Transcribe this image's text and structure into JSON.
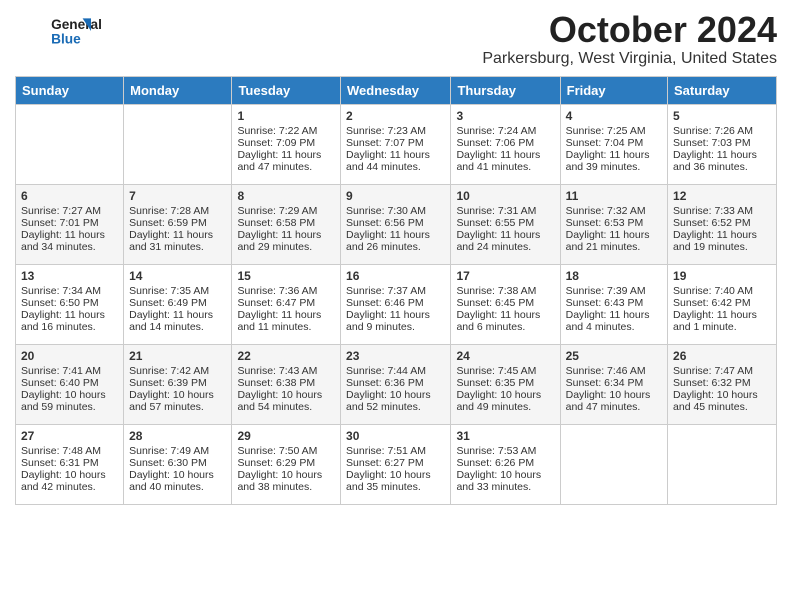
{
  "logo": {
    "line1": "General",
    "line2": "Blue"
  },
  "title": "October 2024",
  "location": "Parkersburg, West Virginia, United States",
  "days_of_week": [
    "Sunday",
    "Monday",
    "Tuesday",
    "Wednesday",
    "Thursday",
    "Friday",
    "Saturday"
  ],
  "weeks": [
    [
      {
        "day": "",
        "sunrise": "",
        "sunset": "",
        "daylight": ""
      },
      {
        "day": "",
        "sunrise": "",
        "sunset": "",
        "daylight": ""
      },
      {
        "day": "1",
        "sunrise": "Sunrise: 7:22 AM",
        "sunset": "Sunset: 7:09 PM",
        "daylight": "Daylight: 11 hours and 47 minutes."
      },
      {
        "day": "2",
        "sunrise": "Sunrise: 7:23 AM",
        "sunset": "Sunset: 7:07 PM",
        "daylight": "Daylight: 11 hours and 44 minutes."
      },
      {
        "day": "3",
        "sunrise": "Sunrise: 7:24 AM",
        "sunset": "Sunset: 7:06 PM",
        "daylight": "Daylight: 11 hours and 41 minutes."
      },
      {
        "day": "4",
        "sunrise": "Sunrise: 7:25 AM",
        "sunset": "Sunset: 7:04 PM",
        "daylight": "Daylight: 11 hours and 39 minutes."
      },
      {
        "day": "5",
        "sunrise": "Sunrise: 7:26 AM",
        "sunset": "Sunset: 7:03 PM",
        "daylight": "Daylight: 11 hours and 36 minutes."
      }
    ],
    [
      {
        "day": "6",
        "sunrise": "Sunrise: 7:27 AM",
        "sunset": "Sunset: 7:01 PM",
        "daylight": "Daylight: 11 hours and 34 minutes."
      },
      {
        "day": "7",
        "sunrise": "Sunrise: 7:28 AM",
        "sunset": "Sunset: 6:59 PM",
        "daylight": "Daylight: 11 hours and 31 minutes."
      },
      {
        "day": "8",
        "sunrise": "Sunrise: 7:29 AM",
        "sunset": "Sunset: 6:58 PM",
        "daylight": "Daylight: 11 hours and 29 minutes."
      },
      {
        "day": "9",
        "sunrise": "Sunrise: 7:30 AM",
        "sunset": "Sunset: 6:56 PM",
        "daylight": "Daylight: 11 hours and 26 minutes."
      },
      {
        "day": "10",
        "sunrise": "Sunrise: 7:31 AM",
        "sunset": "Sunset: 6:55 PM",
        "daylight": "Daylight: 11 hours and 24 minutes."
      },
      {
        "day": "11",
        "sunrise": "Sunrise: 7:32 AM",
        "sunset": "Sunset: 6:53 PM",
        "daylight": "Daylight: 11 hours and 21 minutes."
      },
      {
        "day": "12",
        "sunrise": "Sunrise: 7:33 AM",
        "sunset": "Sunset: 6:52 PM",
        "daylight": "Daylight: 11 hours and 19 minutes."
      }
    ],
    [
      {
        "day": "13",
        "sunrise": "Sunrise: 7:34 AM",
        "sunset": "Sunset: 6:50 PM",
        "daylight": "Daylight: 11 hours and 16 minutes."
      },
      {
        "day": "14",
        "sunrise": "Sunrise: 7:35 AM",
        "sunset": "Sunset: 6:49 PM",
        "daylight": "Daylight: 11 hours and 14 minutes."
      },
      {
        "day": "15",
        "sunrise": "Sunrise: 7:36 AM",
        "sunset": "Sunset: 6:47 PM",
        "daylight": "Daylight: 11 hours and 11 minutes."
      },
      {
        "day": "16",
        "sunrise": "Sunrise: 7:37 AM",
        "sunset": "Sunset: 6:46 PM",
        "daylight": "Daylight: 11 hours and 9 minutes."
      },
      {
        "day": "17",
        "sunrise": "Sunrise: 7:38 AM",
        "sunset": "Sunset: 6:45 PM",
        "daylight": "Daylight: 11 hours and 6 minutes."
      },
      {
        "day": "18",
        "sunrise": "Sunrise: 7:39 AM",
        "sunset": "Sunset: 6:43 PM",
        "daylight": "Daylight: 11 hours and 4 minutes."
      },
      {
        "day": "19",
        "sunrise": "Sunrise: 7:40 AM",
        "sunset": "Sunset: 6:42 PM",
        "daylight": "Daylight: 11 hours and 1 minute."
      }
    ],
    [
      {
        "day": "20",
        "sunrise": "Sunrise: 7:41 AM",
        "sunset": "Sunset: 6:40 PM",
        "daylight": "Daylight: 10 hours and 59 minutes."
      },
      {
        "day": "21",
        "sunrise": "Sunrise: 7:42 AM",
        "sunset": "Sunset: 6:39 PM",
        "daylight": "Daylight: 10 hours and 57 minutes."
      },
      {
        "day": "22",
        "sunrise": "Sunrise: 7:43 AM",
        "sunset": "Sunset: 6:38 PM",
        "daylight": "Daylight: 10 hours and 54 minutes."
      },
      {
        "day": "23",
        "sunrise": "Sunrise: 7:44 AM",
        "sunset": "Sunset: 6:36 PM",
        "daylight": "Daylight: 10 hours and 52 minutes."
      },
      {
        "day": "24",
        "sunrise": "Sunrise: 7:45 AM",
        "sunset": "Sunset: 6:35 PM",
        "daylight": "Daylight: 10 hours and 49 minutes."
      },
      {
        "day": "25",
        "sunrise": "Sunrise: 7:46 AM",
        "sunset": "Sunset: 6:34 PM",
        "daylight": "Daylight: 10 hours and 47 minutes."
      },
      {
        "day": "26",
        "sunrise": "Sunrise: 7:47 AM",
        "sunset": "Sunset: 6:32 PM",
        "daylight": "Daylight: 10 hours and 45 minutes."
      }
    ],
    [
      {
        "day": "27",
        "sunrise": "Sunrise: 7:48 AM",
        "sunset": "Sunset: 6:31 PM",
        "daylight": "Daylight: 10 hours and 42 minutes."
      },
      {
        "day": "28",
        "sunrise": "Sunrise: 7:49 AM",
        "sunset": "Sunset: 6:30 PM",
        "daylight": "Daylight: 10 hours and 40 minutes."
      },
      {
        "day": "29",
        "sunrise": "Sunrise: 7:50 AM",
        "sunset": "Sunset: 6:29 PM",
        "daylight": "Daylight: 10 hours and 38 minutes."
      },
      {
        "day": "30",
        "sunrise": "Sunrise: 7:51 AM",
        "sunset": "Sunset: 6:27 PM",
        "daylight": "Daylight: 10 hours and 35 minutes."
      },
      {
        "day": "31",
        "sunrise": "Sunrise: 7:53 AM",
        "sunset": "Sunset: 6:26 PM",
        "daylight": "Daylight: 10 hours and 33 minutes."
      },
      {
        "day": "",
        "sunrise": "",
        "sunset": "",
        "daylight": ""
      },
      {
        "day": "",
        "sunrise": "",
        "sunset": "",
        "daylight": ""
      }
    ]
  ]
}
